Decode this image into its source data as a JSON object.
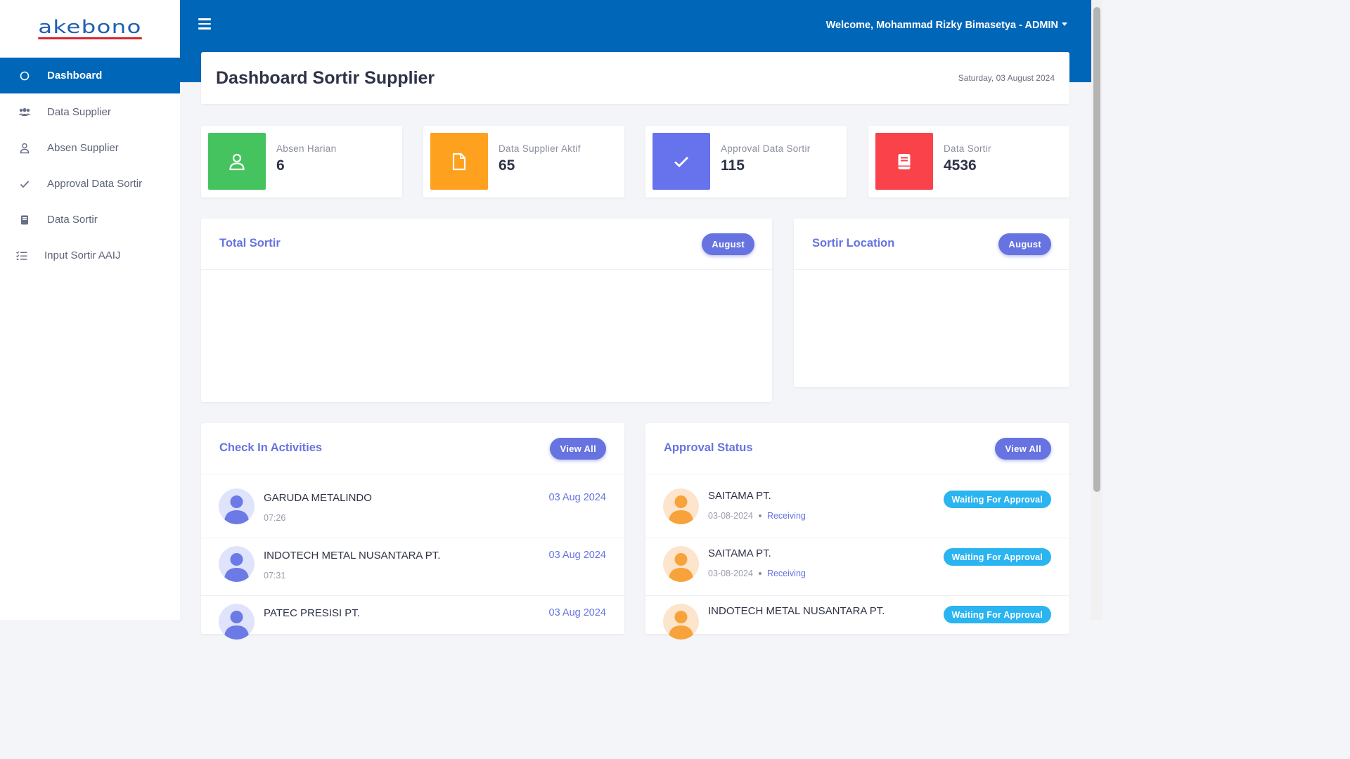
{
  "brand": {
    "logo_text": "akebono"
  },
  "sidebar": {
    "items": [
      {
        "label": "Dashboard",
        "icon": "circle-icon",
        "active": true
      },
      {
        "label": "Data Supplier",
        "icon": "users-icon"
      },
      {
        "label": "Absen Supplier",
        "icon": "user-icon"
      },
      {
        "label": "Approval Data Sortir",
        "icon": "check-icon"
      },
      {
        "label": "Data Sortir",
        "icon": "book-icon"
      },
      {
        "label": "Input Sortir AAIJ",
        "icon": "list-check-icon"
      }
    ]
  },
  "header": {
    "welcome": "Welcome, Mohammad Rizky Bimasetya - ADMIN",
    "menu_icon": "hamburger-icon"
  },
  "page": {
    "title": "Dashboard Sortir Supplier",
    "date": "Saturday, 03 August 2024"
  },
  "stats": [
    {
      "label": "Absen Harian",
      "value": "6",
      "color": "#45c35e",
      "icon": "user-icon"
    },
    {
      "label": "Data Supplier Aktif",
      "value": "65",
      "color": "#fda11e",
      "icon": "file-icon"
    },
    {
      "label": "Approval Data Sortir",
      "value": "115",
      "color": "#6673ed",
      "icon": "check-icon"
    },
    {
      "label": "Data Sortir",
      "value": "4536",
      "color": "#f9424a",
      "icon": "book-icon"
    }
  ],
  "panels": {
    "total_sortir": {
      "title": "Total Sortir",
      "filter": "August"
    },
    "sortir_location": {
      "title": "Sortir Location",
      "filter": "August"
    },
    "checkin": {
      "title": "Check In Activities",
      "button": "View All",
      "items": [
        {
          "name": "GARUDA METALINDO",
          "time": "07:26",
          "date": "03 Aug 2024"
        },
        {
          "name": "INDOTECH METAL NUSANTARA PT.",
          "time": "07:31",
          "date": "03 Aug 2024"
        },
        {
          "name": "PATEC PRESISI PT.",
          "time": "",
          "date": "03 Aug 2024"
        }
      ]
    },
    "approval": {
      "title": "Approval Status",
      "button": "View All",
      "items": [
        {
          "name": "SAITAMA PT.",
          "date": "03-08-2024",
          "dept": "Receiving",
          "status": "Waiting For Approval"
        },
        {
          "name": "SAITAMA PT.",
          "date": "03-08-2024",
          "dept": "Receiving",
          "status": "Waiting For Approval"
        },
        {
          "name": "INDOTECH METAL NUSANTARA PT.",
          "date": "",
          "dept": "",
          "status": "Waiting For Approval"
        }
      ]
    }
  },
  "colors": {
    "primary": "#0066b8",
    "accent": "#6673e0",
    "status": "#2ab4f0"
  }
}
